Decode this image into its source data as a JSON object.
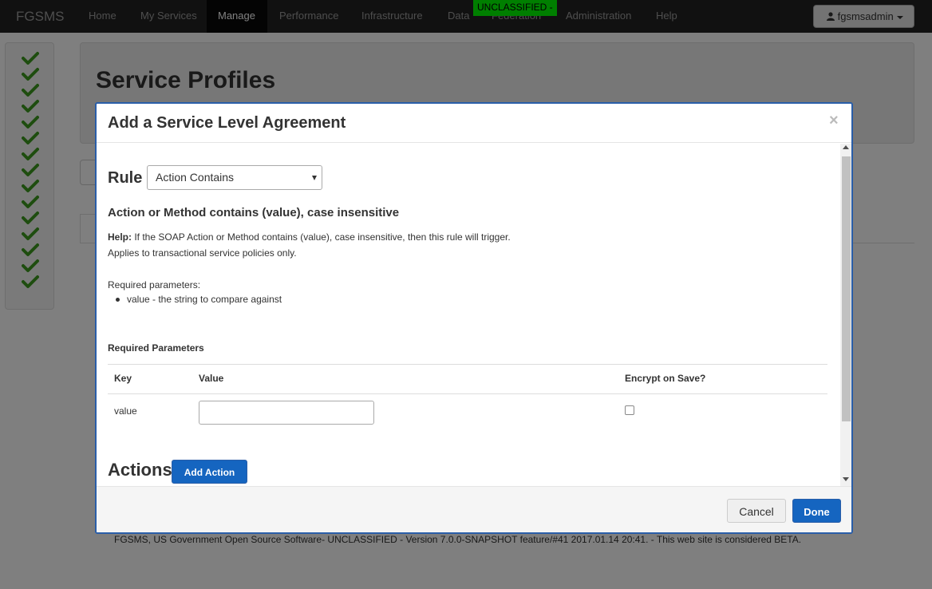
{
  "navbar": {
    "brand": "FGSMS",
    "items": [
      {
        "label": "Home"
      },
      {
        "label": "My Services"
      },
      {
        "label": "Manage"
      },
      {
        "label": "Performance"
      },
      {
        "label": "Infrastructure"
      },
      {
        "label": "Data"
      },
      {
        "label": "Federation"
      },
      {
        "label": "Administration"
      },
      {
        "label": "Help"
      }
    ],
    "classification": "UNCLASSIFIED -",
    "user": "fgsmsadmin"
  },
  "page": {
    "title": "Service Profiles",
    "footer": "FGSMS, US Government Open Source Software- UNCLASSIFIED - Version 7.0.0-SNAPSHOT feature/#41 2017.01.14 20:41. - This web site is considered BETA."
  },
  "modal": {
    "title": "Add a Service Level Agreement",
    "close": "×",
    "rule_label": "Rule",
    "rule_selected": "Action Contains",
    "rule_heading": "Action or Method contains (value), case insensitive",
    "help_label": "Help:",
    "help_text": "If the SOAP Action or Method contains (value), case insensitive, then this rule will trigger.",
    "help_text2": "Applies to transactional service policies only.",
    "required_intro": "Required parameters:",
    "required_items": [
      "value - the string to compare against"
    ],
    "required_heading": "Required Parameters",
    "table": {
      "headers": {
        "key": "Key",
        "value": "Value",
        "encrypt": "Encrypt on Save?"
      },
      "rows": [
        {
          "key": "value",
          "value": "",
          "encrypt": false
        }
      ]
    },
    "actions_label": "Actions",
    "add_action": "Add Action",
    "cancel": "Cancel",
    "done": "Done"
  },
  "colors": {
    "navbar": "#222222",
    "classification": "#00ff00",
    "primary": "#1565c0",
    "modal_border": "#2a5ea8"
  }
}
